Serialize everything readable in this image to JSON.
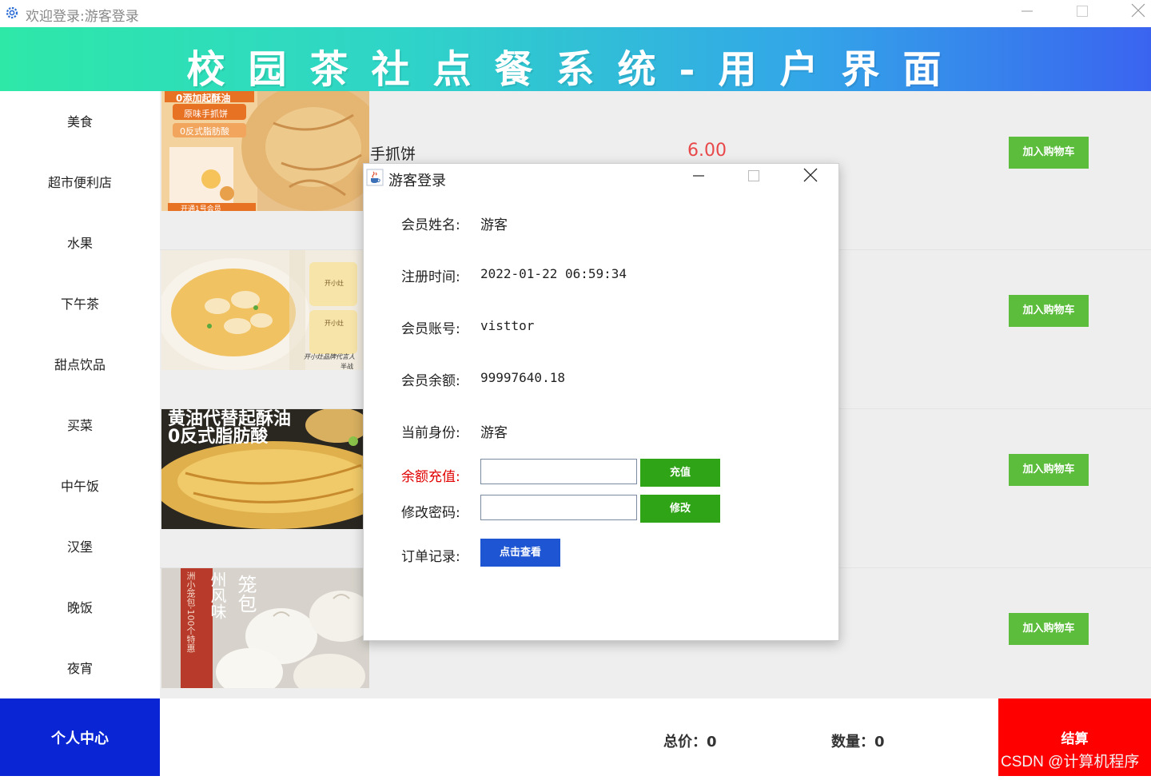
{
  "window": {
    "title": "欢迎登录:游客登录"
  },
  "banner": {
    "title": "校园茶社点餐系统-用户界面"
  },
  "sidebar": {
    "categories": [
      "美食",
      "超市便利店",
      "水果",
      "下午茶",
      "甜点饮品",
      "买菜",
      "中午饭",
      "汉堡",
      "晚饭",
      "夜宵"
    ]
  },
  "products": [
    {
      "name": "手抓饼",
      "price": "6.00",
      "add_label": "加入购物车",
      "image_text": [
        "0添加起酥油",
        "原味手抓饼",
        "0反式脂肪酸",
        "开通1号会员"
      ]
    },
    {
      "name": "",
      "price": "",
      "add_label": "加入购物车",
      "image_text": [
        "开小灶",
        "开小灶",
        "开小灶品牌代言人",
        "半战"
      ]
    },
    {
      "name": "",
      "price": "",
      "add_label": "加入购物车",
      "image_text": [
        "黄油代替起酥油",
        "0反式脂肪酸"
      ]
    },
    {
      "name": "",
      "price": "",
      "add_label": "加入购物车",
      "image_text": [
        "州风味",
        "笼包",
        "洲小笼包·100个特惠"
      ]
    }
  ],
  "footer": {
    "personal_center": "个人中心",
    "total": "总价：0",
    "count": "数量：0",
    "checkout": "结算"
  },
  "watermark": "CSDN @计算机程序",
  "dialog": {
    "title": "游客登录",
    "name_label": "会员姓名:",
    "name_value": "游客",
    "reg_label": "注册时间:",
    "reg_value": "2022-01-22 06:59:34",
    "account_label": "会员账号:",
    "account_value": "visttor",
    "balance_label": "会员余额:",
    "balance_value": "99997640.18",
    "identity_label": "当前身份:",
    "identity_value": "游客",
    "recharge_label": "余额充值:",
    "recharge_value": "",
    "recharge_button": "充值",
    "password_label": "修改密码:",
    "password_value": "",
    "password_button": "修改",
    "orders_label": "订单记录:",
    "orders_button": "点击查看"
  },
  "colors": {
    "accent_green": "#5cbd3c",
    "dialog_green": "#2fa416",
    "blue": "#1e55d3",
    "nav_blue": "#0a25d3",
    "red": "#ff0000",
    "price_red": "#e8484a"
  },
  "icons": [
    "gear-icon",
    "minimize-icon",
    "maximize-icon",
    "close-icon",
    "java-cup-icon"
  ]
}
